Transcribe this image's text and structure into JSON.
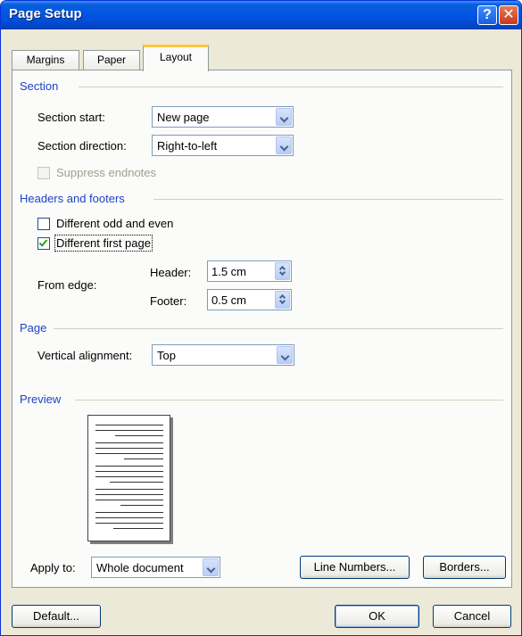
{
  "window": {
    "title": "Page Setup"
  },
  "titlebar": {
    "help": "?",
    "close": "✕"
  },
  "tabs": [
    {
      "label": "Margins"
    },
    {
      "label": "Paper"
    },
    {
      "label": "Layout"
    }
  ],
  "section": {
    "heading": "Section",
    "start_label": "Section start:",
    "start_value": "New page",
    "direction_label": "Section direction:",
    "direction_value": "Right-to-left",
    "suppress_label": "Suppress endnotes",
    "suppress_checked": false
  },
  "headers_footers": {
    "heading": "Headers and footers",
    "odd_even_label": "Different odd and even",
    "odd_even_checked": false,
    "first_page_label": "Different first page",
    "first_page_checked": true,
    "from_edge_label": "From edge:",
    "header_label": "Header:",
    "header_value": "1.5 cm",
    "footer_label": "Footer:",
    "footer_value": "0.5 cm"
  },
  "page": {
    "heading": "Page",
    "valign_label": "Vertical alignment:",
    "valign_value": "Top"
  },
  "preview": {
    "heading": "Preview",
    "apply_label": "Apply to:",
    "apply_value": "Whole document",
    "line_numbers_label": "Line Numbers...",
    "borders_label": "Borders..."
  },
  "footer": {
    "default_label": "Default...",
    "ok_label": "OK",
    "cancel_label": "Cancel"
  },
  "colors": {
    "title_bar": "#0055e5",
    "group_heading": "#1e43c8",
    "active_tab_accent": "#ffc83c",
    "check_mark": "#21a121"
  }
}
